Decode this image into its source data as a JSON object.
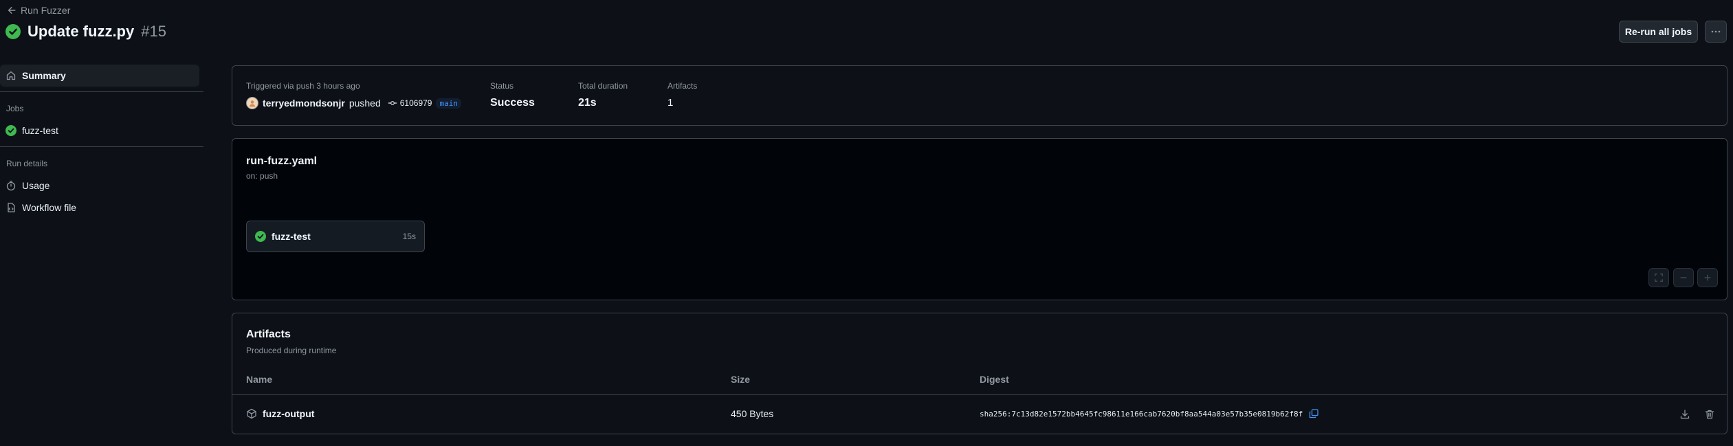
{
  "header": {
    "back_label": "Run Fuzzer",
    "title": "Update fuzz.py",
    "run_number": "#15",
    "rerun_label": "Re-run all jobs"
  },
  "sidebar": {
    "summary_label": "Summary",
    "jobs_heading": "Jobs",
    "jobs": [
      {
        "label": "fuzz-test"
      }
    ],
    "run_details_heading": "Run details",
    "details": [
      {
        "label": "Usage"
      },
      {
        "label": "Workflow file"
      }
    ]
  },
  "summary": {
    "trigger_text": "Triggered via push 3 hours ago",
    "user": "terryedmondsonjr",
    "action": "pushed",
    "commit": "6106979",
    "branch": "main",
    "status_label": "Status",
    "status_value": "Success",
    "duration_label": "Total duration",
    "duration_value": "21s",
    "artifacts_label": "Artifacts",
    "artifacts_value": "1"
  },
  "workflow": {
    "file": "run-fuzz.yaml",
    "trigger": "on: push",
    "job_name": "fuzz-test",
    "job_duration": "15s"
  },
  "artifacts": {
    "title": "Artifacts",
    "subtitle": "Produced during runtime",
    "columns": {
      "name": "Name",
      "size": "Size",
      "digest": "Digest"
    },
    "rows": [
      {
        "name": "fuzz-output",
        "size": "450 Bytes",
        "digest": "sha256:7c13d82e1572bb4645fc98611e166cab7620bf8aa544a03e57b35e0819b62f8f"
      }
    ]
  },
  "colors": {
    "success": "#3fb950",
    "background": "#0d1117",
    "border": "#3d444d",
    "accent": "#4493f8"
  }
}
